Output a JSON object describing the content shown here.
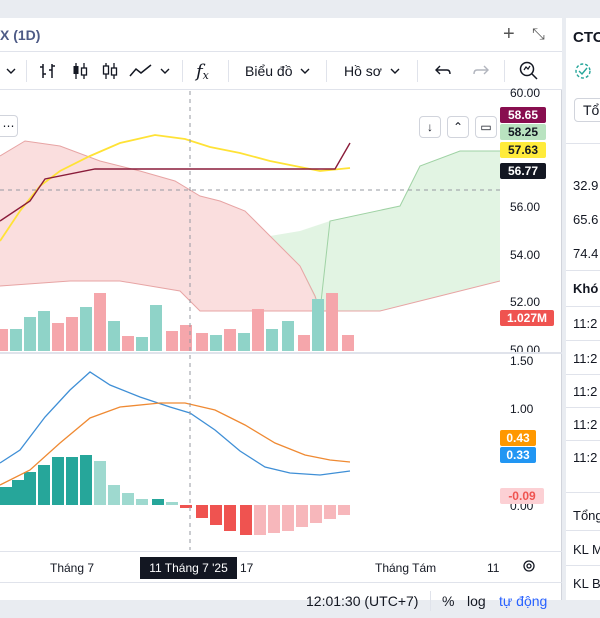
{
  "window": {
    "title": "X (1D)",
    "add_icon": "plus-icon",
    "collapse_icon": "collapse-arrows-icon"
  },
  "toolbar": {
    "bars_icon": "bars-chart-icon",
    "candles_icon": "candles-chart-icon",
    "hollow_icon": "hollow-candles-icon",
    "line_icon": "line-chart-icon",
    "indicator_icon": "fx-icon",
    "chart_label": "Biểu đồ",
    "profile_label": "Hồ sơ",
    "undo_icon": "undo-icon",
    "redo_icon": "redo-icon",
    "search_icon": "search-icon"
  },
  "price_axis": {
    "ticks": [
      "60.00",
      "56.00",
      "54.00",
      "52.00",
      "50.00"
    ],
    "tag_red": "58.65",
    "tag_green": "58.25",
    "tag_yellow": "57.63",
    "tag_crosshair": "56.77",
    "tag_volume": "1.027M"
  },
  "macd_axis": {
    "ticks": [
      "1.50",
      "1.00",
      "0.00"
    ],
    "tag_orange": "0.43",
    "tag_blue": "0.33",
    "tag_hist": "-0.09"
  },
  "time_axis": {
    "labels": [
      "Tháng 7",
      "17",
      "Tháng Tám",
      "11"
    ],
    "crosshair": "11 Tháng 7 '25"
  },
  "status": {
    "time": "12:01:30 (UTC+7)",
    "percent": "%",
    "log": "log",
    "auto": "tự động"
  },
  "right_panel": {
    "symbol": "CTO",
    "total_btn": "Tổ",
    "values": [
      "32.9",
      "65.6",
      "74.4"
    ],
    "section": "Khó",
    "times": [
      "11:2",
      "11:2",
      "11:2",
      "11:2",
      "11:2"
    ],
    "footer": [
      "Tổng",
      "KL M",
      "KL B"
    ]
  },
  "colors": {
    "up": "#26a69a",
    "down": "#ef5350",
    "yellow": "#ffeb3b",
    "blue": "#2196f3",
    "orange": "#ff9800",
    "maroon": "#880e4f"
  }
}
